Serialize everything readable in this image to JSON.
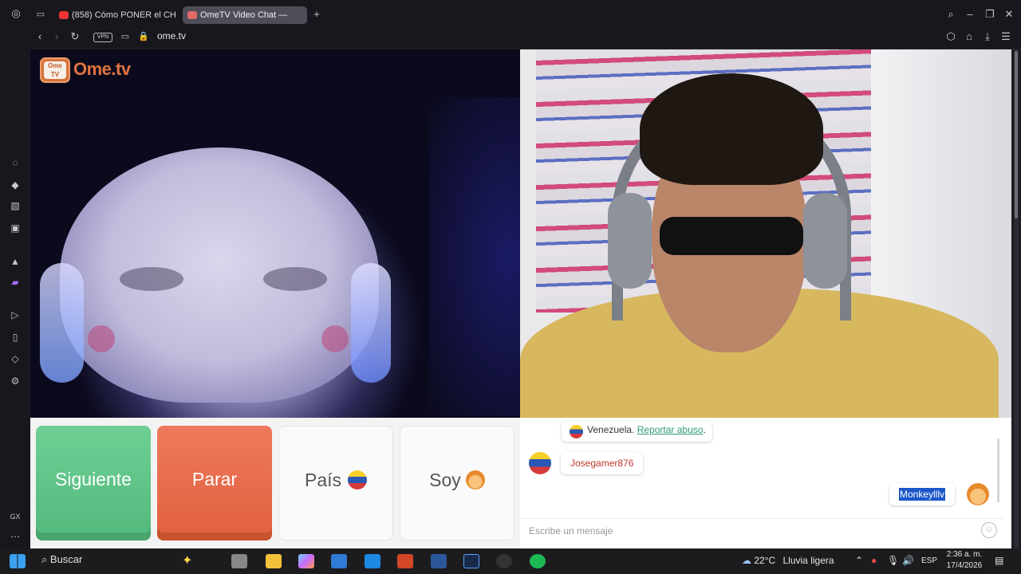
{
  "browser": {
    "tabs": [
      {
        "label": "(858) Cómo PONER el CH/",
        "active": false
      },
      {
        "label": "OmeTV Video Chat —",
        "active": true
      }
    ],
    "new_tab": "+",
    "vpn_label": "VPN",
    "url": "ome.tv"
  },
  "video": {
    "logo_tv": "Ome TV",
    "logo_word": "Ome.tv"
  },
  "controls": {
    "next_label": "Siguiente",
    "stop_label": "Parar",
    "country_label": "País",
    "gender_label": "Soy"
  },
  "chat": {
    "system_country": "Venezuela.",
    "report_link": "Reportar abuso",
    "report_suffix": ".",
    "stranger_name": "Josegamer876",
    "my_name": "Monkeylllv",
    "input_placeholder": "Escribe un mensaje"
  },
  "taskbar": {
    "search_label": "Buscar",
    "weather_temp": "22°C",
    "weather_text": "Lluvia ligera",
    "language": "ESP",
    "time": "2:36 a. m.",
    "date": "17/4/2026"
  },
  "colors": {
    "next": "#5bc487",
    "stop": "#e56c4b",
    "brand": "#e2743f",
    "report_link": "#2f9a6e",
    "stranger_name": "#c0392b"
  }
}
